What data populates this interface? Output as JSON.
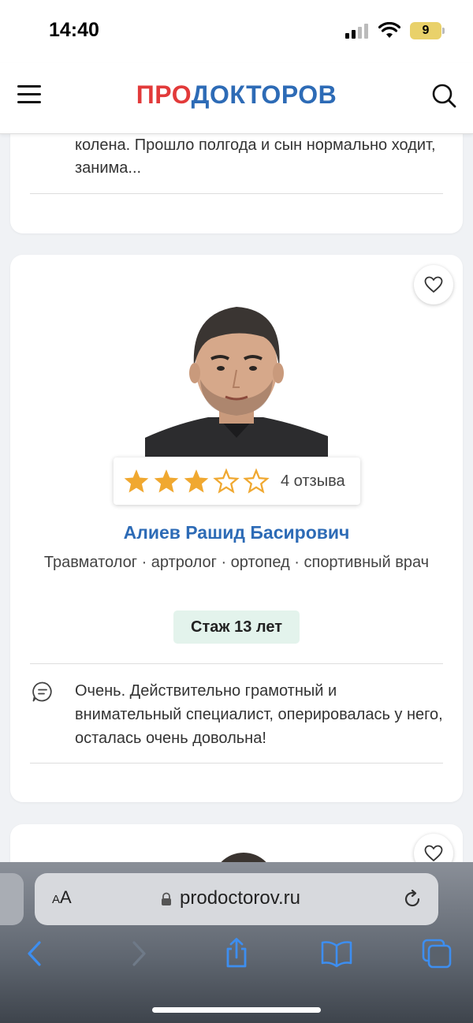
{
  "status_bar": {
    "time": "14:40",
    "battery": "9",
    "icons": [
      "signal-icon",
      "wifi-icon",
      "battery-icon"
    ]
  },
  "header": {
    "logo_pro": "ПРО",
    "logo_doctor": "ДОКТОРОВ",
    "icons": [
      "menu-icon",
      "search-icon"
    ]
  },
  "previous_card": {
    "review_text": "колена. Прошло полгода и сын нормально ходит, занима..."
  },
  "doctor_card": {
    "rating": {
      "stars": 3,
      "max": 5,
      "reviews": "4 отзыва"
    },
    "name": "Алиев Рашид Басирович",
    "specialties": "Травматолог · артролог · ортопед · спортивный врач",
    "experience": "Стаж 13 лет",
    "review_text": "Очень. Действительно грамотный и внимательный специалист, оперировалась у него, осталась очень довольна!"
  },
  "browser": {
    "aa_label_small": "A",
    "aa_label_large": "A",
    "url": "prodoctorov.ru",
    "toolbar_icons": [
      "back-icon",
      "forward-icon",
      "share-icon",
      "bookmarks-icon",
      "tabs-icon"
    ]
  },
  "colors": {
    "brand_red": "#e23a3a",
    "brand_blue": "#2d6bb6",
    "star": "#f0a830",
    "experience_bg": "#e3f3ec"
  }
}
